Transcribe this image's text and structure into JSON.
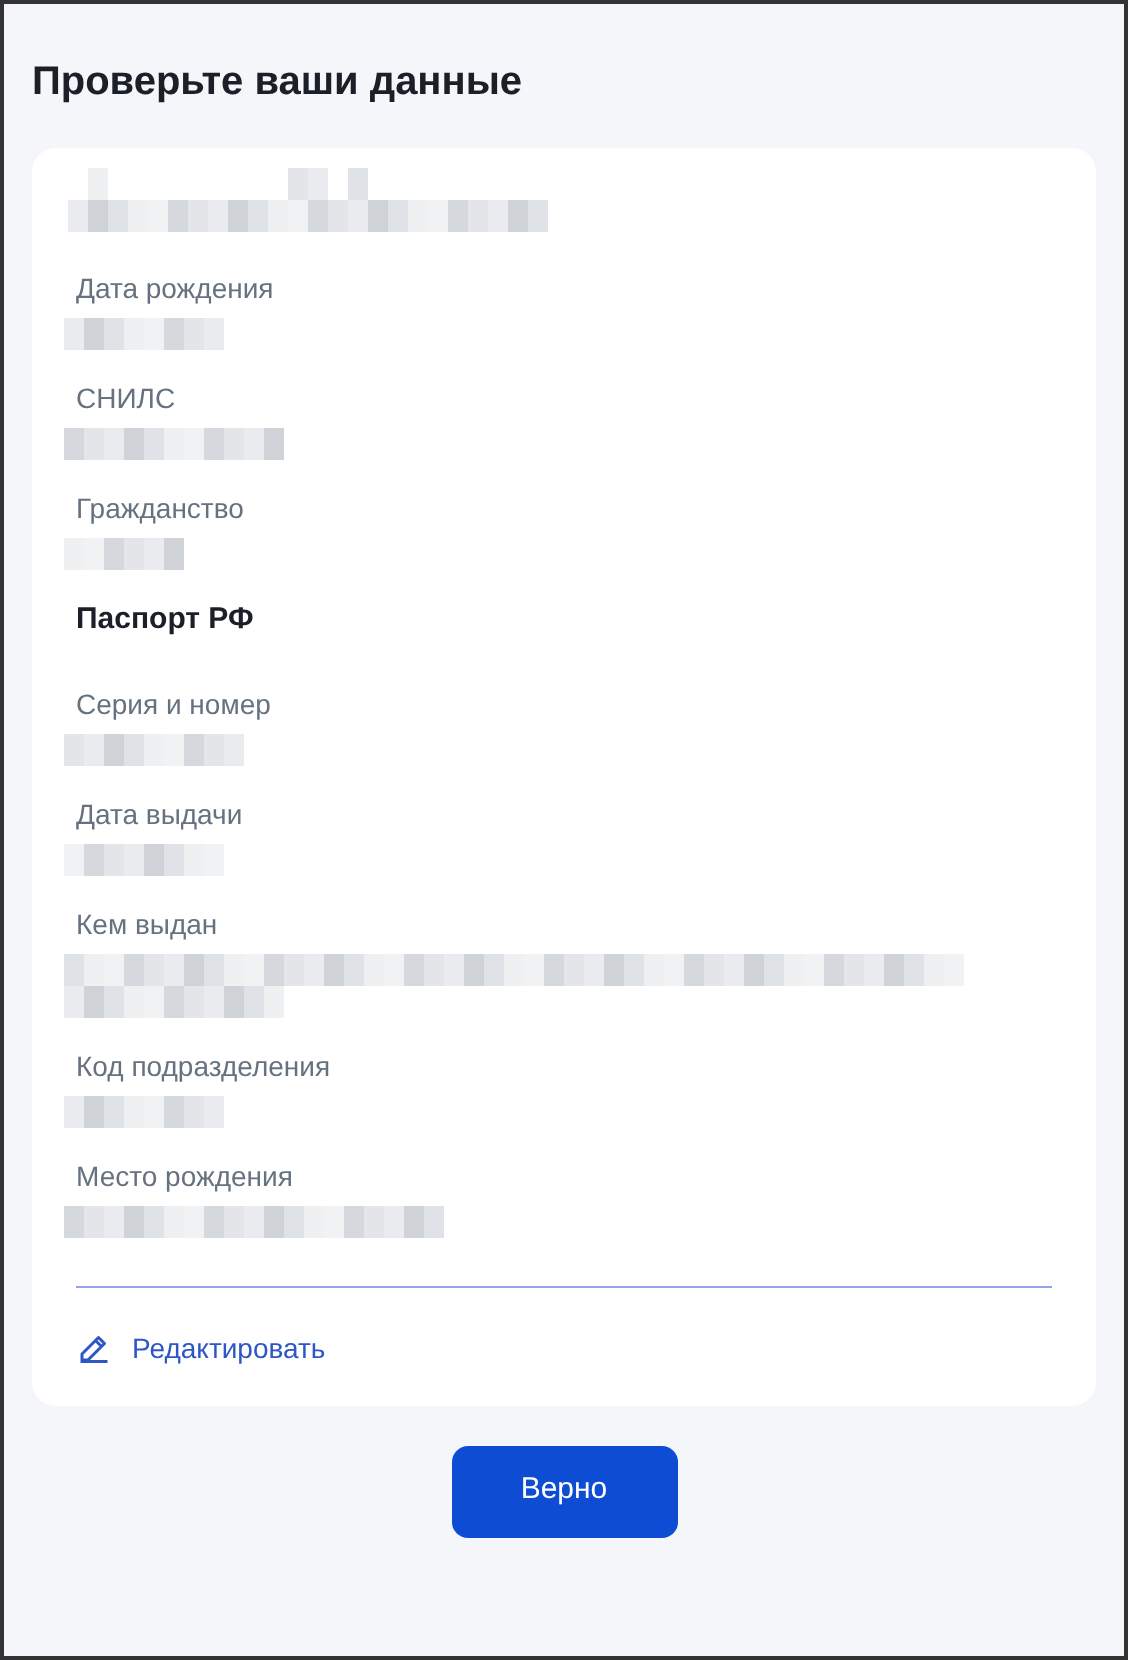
{
  "title": "Проверьте ваши данные",
  "items": [
    {
      "kind": "value"
    },
    {
      "kind": "field",
      "label": "Дата рождения"
    },
    {
      "kind": "field",
      "label": "СНИЛС"
    },
    {
      "kind": "field",
      "label": "Гражданство"
    },
    {
      "kind": "heading",
      "label": "Паспорт РФ"
    },
    {
      "kind": "field",
      "label": "Серия и номер"
    },
    {
      "kind": "field",
      "label": "Дата выдачи"
    },
    {
      "kind": "field",
      "label": "Кем выдан"
    },
    {
      "kind": "field",
      "label": "Код подразделения"
    },
    {
      "kind": "field",
      "label": "Место рождения"
    }
  ],
  "edit_link": "Редактировать",
  "confirm_button": "Верно"
}
